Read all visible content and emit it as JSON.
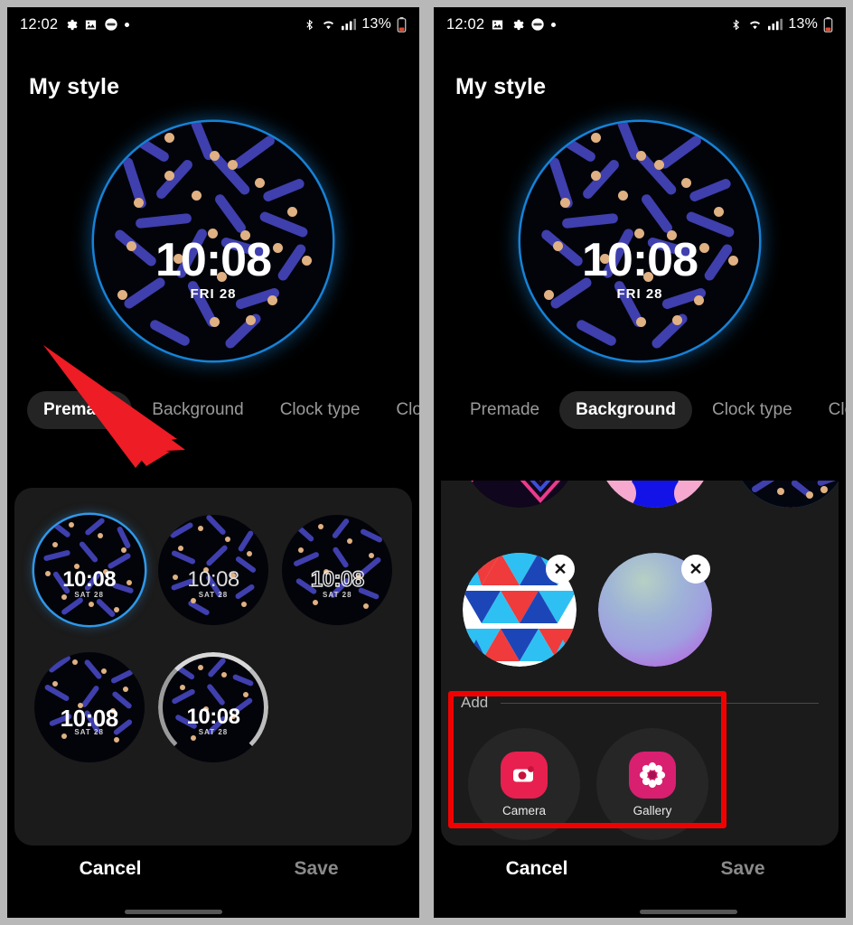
{
  "statusbar": {
    "time": "12:02",
    "left_icons": [
      "gear-icon",
      "image-icon",
      "pill-badge-icon",
      "dot-icon"
    ],
    "right_icons": [
      "bluetooth-icon",
      "wifi-icon",
      "signal-icon"
    ],
    "battery_percent": "13%",
    "battery_level_color": "#e04a2f"
  },
  "page_title": "My style",
  "preview": {
    "time": "10:08",
    "date": "FRI 28",
    "ring_color": "#1782d6"
  },
  "tabs": {
    "items": [
      {
        "label": "Premade"
      },
      {
        "label": "Background"
      },
      {
        "label": "Clock type"
      },
      {
        "label": "Clo"
      }
    ],
    "left_active": "Premade",
    "right_active": "Background"
  },
  "left_panel": {
    "faces": [
      {
        "time": "10:08",
        "date": "SAT 28",
        "selected": true,
        "style": "plain"
      },
      {
        "time": "10:08",
        "date": "SAT 28",
        "selected": false,
        "style": "plain"
      },
      {
        "time": "10:08",
        "date": "SAT 28",
        "selected": false,
        "style": "outline"
      },
      {
        "time": "10:08",
        "date": "SAT 28",
        "selected": false,
        "style": "bold"
      },
      {
        "time": "10:08",
        "date": "SAT 28",
        "selected": false,
        "style": "ticker"
      }
    ]
  },
  "right_panel": {
    "clipped_backgrounds": [
      {
        "name": "zigzag-pattern"
      },
      {
        "name": "floral-pattern"
      },
      {
        "name": "confetti-watchface"
      }
    ],
    "user_backgrounds": [
      {
        "name": "geometric-triangles",
        "remove_label": "✕"
      },
      {
        "name": "gradient-sphere",
        "remove_label": "✕"
      }
    ],
    "add_section": {
      "label": "Add",
      "apps": [
        {
          "label": "Camera",
          "icon": "camera-icon",
          "color": "#e8204f"
        },
        {
          "label": "Gallery",
          "icon": "gallery-icon",
          "color": "#d91f70"
        }
      ]
    },
    "highlight_color": "#f20000"
  },
  "footer": {
    "cancel_label": "Cancel",
    "save_label": "Save"
  },
  "annotation": {
    "arrow_color": "#ee1c25",
    "arrow_points_to": "Background"
  }
}
